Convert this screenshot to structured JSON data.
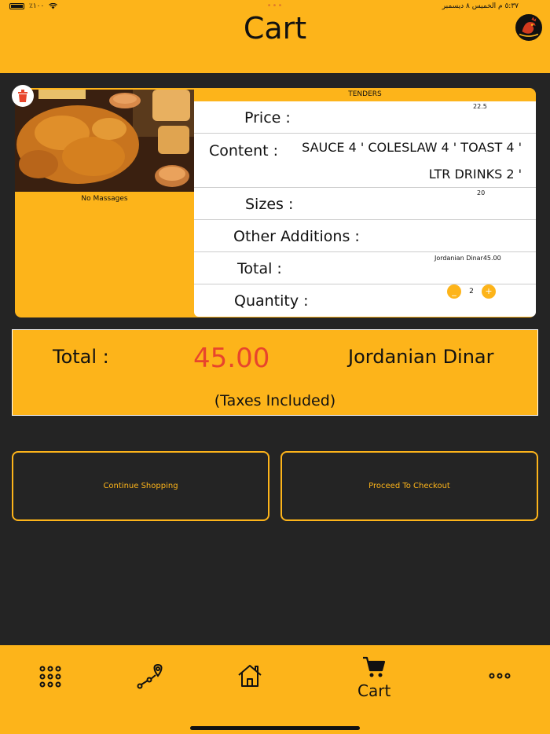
{
  "status_bar": {
    "battery": "٪١٠٠",
    "datetime": "٥:٣٧ م  الخميس ٨ ديسمبر",
    "dots": "•••"
  },
  "header": {
    "title": "Cart"
  },
  "cart_item": {
    "name": "TENDERS",
    "note": "No Massages",
    "price_label": "Price :",
    "price_value": "22.5",
    "content_label": "Content :",
    "content_line1": "SAUCE 4 ' COLESLAW 4 ' TOAST 4 '",
    "content_line2": "LTR DRINKS 2 '",
    "sizes_label": "Sizes :",
    "sizes_value": "20",
    "other_label": "Other Additions :",
    "total_label": "Total :",
    "total_value": "Jordanian Dinar45.00",
    "qty_label": "Quantity :",
    "qty_minus": "_",
    "qty_value": "2",
    "qty_plus": "+"
  },
  "summary": {
    "label": "Total :",
    "amount": "45.00",
    "currency": "Jordanian Dinar",
    "tax_note": "(Taxes Included)"
  },
  "actions": {
    "continue": "Continue Shopping",
    "checkout": "Proceed To Checkout"
  },
  "nav": {
    "cart_label": "Cart"
  },
  "colors": {
    "accent": "#fdb41a",
    "background": "#242424",
    "amount": "#e8452c"
  }
}
